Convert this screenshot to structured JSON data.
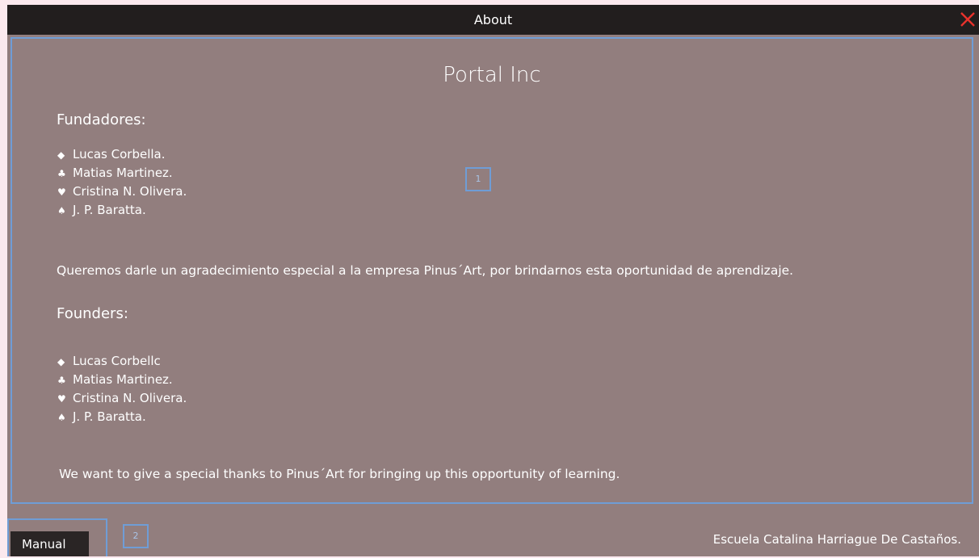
{
  "window": {
    "title": "About",
    "close_color": "#e8322c"
  },
  "about": {
    "company": "Portal Inc",
    "es": {
      "heading": "Fundadores:",
      "founders": [
        {
          "symbol": "◆",
          "name": "Lucas Corbella."
        },
        {
          "symbol": "♣",
          "name": "Matias Martinez."
        },
        {
          "symbol": "♥",
          "name": "Cristina N. Olivera."
        },
        {
          "symbol": "♠",
          "name": "J. P. Baratta."
        }
      ],
      "thanks": "Queremos darle un agradecimiento especial a la empresa Pinus´Art, por brindarnos esta oportunidad de aprendizaje."
    },
    "en": {
      "heading": "Founders:",
      "founders": [
        {
          "symbol": "◆",
          "name": "Lucas Corbellc"
        },
        {
          "symbol": "♣",
          "name": "Matias Martinez."
        },
        {
          "symbol": "♥",
          "name": "Cristina N. Olivera."
        },
        {
          "symbol": "♠",
          "name": "J. P. Baratta."
        }
      ],
      "thanks": "We want to give a special thanks to Pinus´Art for bringing up this opportunity of learning."
    }
  },
  "markers": {
    "content": "1",
    "footer": "2"
  },
  "footer": {
    "manual_label": "Manual",
    "school": "Escuela Catalina Harriague De Castaños."
  },
  "colors": {
    "panel_bg": "#927e7e",
    "titlebar_bg": "#221e1e",
    "highlight_border": "#6f9dd6"
  }
}
